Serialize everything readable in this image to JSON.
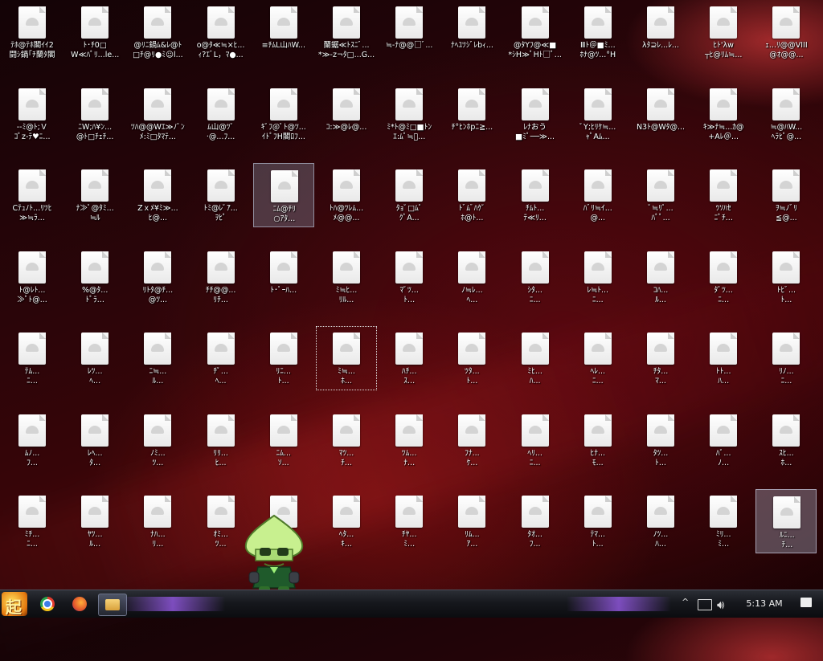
{
  "desktop": {
    "icons": [
      "ﾃﾎ@ﾃﾎ閣ｲｲ2\n闘ｼ鍋｢ﾁ蘭ﾀ閣",
      "ﾄ･ﾁ0□\nW≪ﾊﾟﾘ...le...",
      "@ﾘﾆ鍋ﾑ&ﾚ@ﾄ\n□ﾁ@ﾘ●ﾐ☺l...",
      "o@ﾀ≪≒×ﾋ...\nｨ?ｴﾞL，ﾏ●...",
      "≡ﾁﾑL山ﾊW...\n",
      "蘭鋸≪ﾄｽﾆﾞ...\n*≫-z¬ﾀ□...G...",
      "≒-ﾅ@@□ﾞ...",
      "ﾅﾍﾕﾂｼﾞﾚbｨ...",
      "@ﾀYﾌ@≪■\n*ｼH≫ﾟHﾄ□ﾟ...",
      "Ⅲﾄ＠■ﾐ...\nﾎﾅ@ﾂ...°H",
      "λﾀ⊇ﾚ...ﾚ...",
      "ﾋﾄ'λw\n┬ﾋ@ﾘﾑ≒...",
      "ｪ...ﾘ@@VIII\n@ｵ@@...",
      "--ﾐ@ﾄ;Ｖ\nｺﾟz-ﾃ♥ﾆ...",
      "ﾆW;ﾊ¥ﾝ...\n@ﾄ□ﾁｪﾁ...",
      "ﾂﾊ@@Wｴ≫ﾉﾟﾝ\nﾒ:ﾐ□ﾀﾏﾃ...",
      "ﾑ山@ﾂﾟ\n·@...ﾌ...",
      "ｷﾟﾌ@ﾟﾄ@ﾂ...\nｲﾄﾟﾌH閣ﾛﾌ...",
      "ｺ:≫@ﾚ@...\n",
      "ﾐ*ﾄ@ﾐ□■ﾄﾝ\nｴ:ﾑﾟ≒ﾟ...",
      "ﾁ°ﾋﾝﾎpﾆ≧...",
      "ﾚﾅおう\n■ﾐﾟ──≫...",
      "ﾟY;ﾋﾘｹ≒...\nｬﾟAﾑ...",
      "N3ﾄ@Wﾀ@...\n",
      "ｷ≫ﾅ≒...ｶ@\n+Aﾚ＠...",
      "≒@ﾊW...\nﾍﾗﾋﾟ@...",
      "Cﾃｭﾉﾄ...ﾘﾂﾋ\n≫≒ﾗ...",
      "ﾅ≫ﾟ@ﾀﾐ...\n≒ﾙ",
      "Zｘﾒ¥ﾐ≫...\nﾋ@...",
      "ﾄﾐ@ﾚﾟｱ...\nｦﾋﾟ",
      "ﾆﾑ@ﾁﾘ\n○ｱﾀ...",
      "ﾄﾊ@ﾂﾚﾑ...\nﾒ@@...",
      "ﾀｮﾟ□ﾑﾟ\nｸﾟA...",
      "ﾄﾞﾑﾞﾊｹﾟ\nﾎ@ﾄ...",
      "ﾁﾑﾄ...\nﾃ≪ﾘ...",
      "ﾊﾞﾘ≒ｲ...\n@...",
      "ﾟ≒ﾘﾟ...\nﾊﾟﾟ...",
      "ﾂｿﾊｾ\nﾆﾟﾁ...",
      "ｦ≒ﾉﾞﾘ\n≦@...",
      "ﾄ@ﾚﾄ...\n≫ﾟﾄ@...",
      "%@ﾀ...\nﾄﾟﾗ...",
      "ﾘﾄﾀ@ﾁ...\n@ﾂ...",
      "ﾁﾁ@@...\nﾘﾁ...",
      "ﾄ･ﾟｰﾊ...",
      "ﾐ≒ﾋ...\nﾘﾙ...",
      "ﾏﾟﾂ...\nﾄ...",
      "ﾉ≒ﾚ...\nﾍ...",
      "ｼﾀ...\nﾆ...",
      "ﾚ≒ﾄ...\nﾆ...",
      "ｺﾊ...\nﾙ...",
      "ﾀﾟﾂ...\nﾆ...",
      "ﾄﾋﾞ...\nﾄ...",
      "ﾃﾑ...\nﾆ...",
      "ﾚﾂ...\nﾍ...",
      "ﾆ≒...\nﾙ...",
      "ﾁﾟ...\nﾍ...",
      "ﾘﾆ...\nﾄ...",
      "ﾐ≒...\nﾎ...",
      "ﾊﾁ...\nｽ...",
      "ﾂﾀ...\nﾄ...",
      "ﾐﾋ...\nﾊ...",
      "ﾍﾚ...\nﾆ...",
      "ﾁﾀ...\nﾏ...",
      "ﾄﾄ...\nﾊ...",
      "ﾘﾉ...\nﾆ...",
      "ﾑﾉ...\nﾌ...",
      "ﾚﾍ...\nﾀ...",
      "ﾉﾐ...\nﾂ...",
      "ﾘﾘ...\nﾋ...",
      "ﾆﾑ...\nｿ...",
      "ﾏﾂ...\nﾁ...",
      "ﾂﾑ...\nﾅ...",
      "ﾌﾅ...\nｹ...",
      "ﾍﾘ...\nﾆ...",
      "ﾋﾅ...\nﾓ...",
      "ﾀﾂ...\nﾄ...",
      "ﾊﾟ...\nﾉ...",
      "ｽﾋ...\nﾎ...",
      "ﾐﾁ...\nﾆ...",
      "ﾔﾂ...\nﾙ...",
      "ﾅﾊ...\nﾘ...",
      "ｵﾐ...\nﾂ...",
      "ﾈﾊ...\nﾆ...",
      "ﾍﾀ...\nｷ...",
      "ﾁﾔ...\nﾐ...",
      "ﾘﾑ...\nｱ...",
      "ﾀｵ...\nﾌ...",
      "ﾃﾏ...\nﾄ...",
      "ﾉﾂ...\nﾊ...",
      "ﾐﾘ...\nﾐ...",
      "ﾙﾆ...\nﾁ..."
    ]
  },
  "taskbar": {
    "start_label": "起",
    "apps": [
      "Chrome",
      "Firefox",
      "File Explorer"
    ],
    "tray": {
      "time": "5:13 AM"
    }
  }
}
